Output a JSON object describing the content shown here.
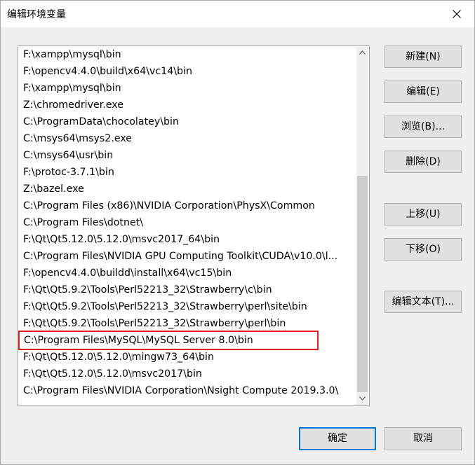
{
  "window": {
    "title": "编辑环境变量"
  },
  "path_list": {
    "items": [
      "F:\\xampp\\mysql\\bin",
      "F:\\opencv4.4.0\\build\\x64\\vc14\\bin",
      "F:\\xampp\\mysql\\bin",
      "Z:\\chromedriver.exe",
      "C:\\ProgramData\\chocolatey\\bin",
      "C:\\msys64\\msys2.exe",
      "C:\\msys64\\usr\\bin",
      "F:\\protoc-3.7.1\\bin",
      "Z:\\bazel.exe",
      "C:\\Program Files (x86)\\NVIDIA Corporation\\PhysX\\Common",
      "C:\\Program Files\\dotnet\\",
      "F:\\Qt\\Qt5.12.0\\5.12.0\\msvc2017_64\\bin",
      "C:\\Program Files\\NVIDIA GPU Computing Toolkit\\CUDA\\v10.0\\l...",
      "F:\\opencv4.4.0\\buildd\\install\\x64\\vc15\\bin",
      "F:\\Qt\\Qt5.9.2\\Tools\\Perl52213_32\\Strawberry\\c\\bin",
      "F:\\Qt\\Qt5.9.2\\Tools\\Perl52213_32\\Strawberry\\perl\\site\\bin",
      "F:\\Qt\\Qt5.9.2\\Tools\\Perl52213_32\\Strawberry\\perl\\bin",
      "C:\\Program Files\\MySQL\\MySQL Server 8.0\\bin",
      "F:\\Qt\\Qt5.12.0\\5.12.0\\mingw73_64\\bin",
      "F:\\Qt\\Qt5.12.0\\5.12.0\\msvc2017\\bin",
      "C:\\Program Files\\NVIDIA Corporation\\Nsight Compute 2019.3.0\\"
    ],
    "highlighted_item": "C:\\Program Files\\MySQL\\MySQL Server 8.0\\bin",
    "highlight_color": "#e02020"
  },
  "scrollbar": {
    "up_icon": "chevron-up-icon",
    "down_icon": "chevron-down-icon"
  },
  "buttons": {
    "new": "新建(N)",
    "edit": "编辑(E)",
    "browse": "浏览(B)...",
    "delete": "删除(D)",
    "move_up": "上移(U)",
    "move_down": "下移(O)",
    "edit_text": "编辑文本(T)..."
  },
  "footer": {
    "ok": "确定",
    "cancel": "取消"
  },
  "colors": {
    "default_button_border": "#0078d7"
  }
}
